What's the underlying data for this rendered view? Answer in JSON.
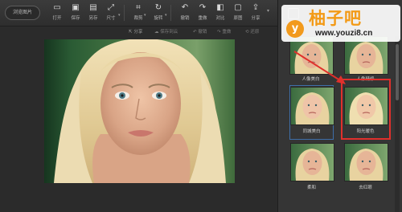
{
  "topbar": {
    "browse_label": "浏览图片",
    "tools": [
      {
        "label": "打开",
        "icon": "open-icon"
      },
      {
        "label": "保存",
        "icon": "save-icon"
      },
      {
        "label": "另存",
        "icon": "save-as-icon"
      },
      {
        "label": "尺寸",
        "icon": "resize-icon"
      },
      {
        "label": "裁剪",
        "icon": "crop-icon"
      },
      {
        "label": "旋转",
        "icon": "rotate-icon"
      },
      {
        "label": "撤销",
        "icon": "undo-icon"
      },
      {
        "label": "重做",
        "icon": "redo-icon"
      },
      {
        "label": "对比",
        "icon": "compare-icon"
      },
      {
        "label": "原图",
        "icon": "original-icon"
      },
      {
        "label": "分享",
        "icon": "share-icon"
      }
    ]
  },
  "subbar": {
    "items": [
      "分享",
      "保存到云",
      "撤销",
      "重做",
      "还原"
    ]
  },
  "panel": {
    "thumbnails": [
      {
        "label": "人像美白"
      },
      {
        "label": "人像精修"
      },
      {
        "label": "同城美白"
      },
      {
        "label": "阳光暖色"
      },
      {
        "label": "柔和"
      },
      {
        "label": "去红眼"
      }
    ]
  },
  "watermark": {
    "logo_letter": "y",
    "title": "柚子吧",
    "url": "www.youzi8.cn",
    "accent": "#f39a16"
  },
  "colors": {
    "background": "#2b2b2b",
    "panel": "#353535",
    "selection": "#e0302c",
    "arrow": "#e0302c"
  }
}
